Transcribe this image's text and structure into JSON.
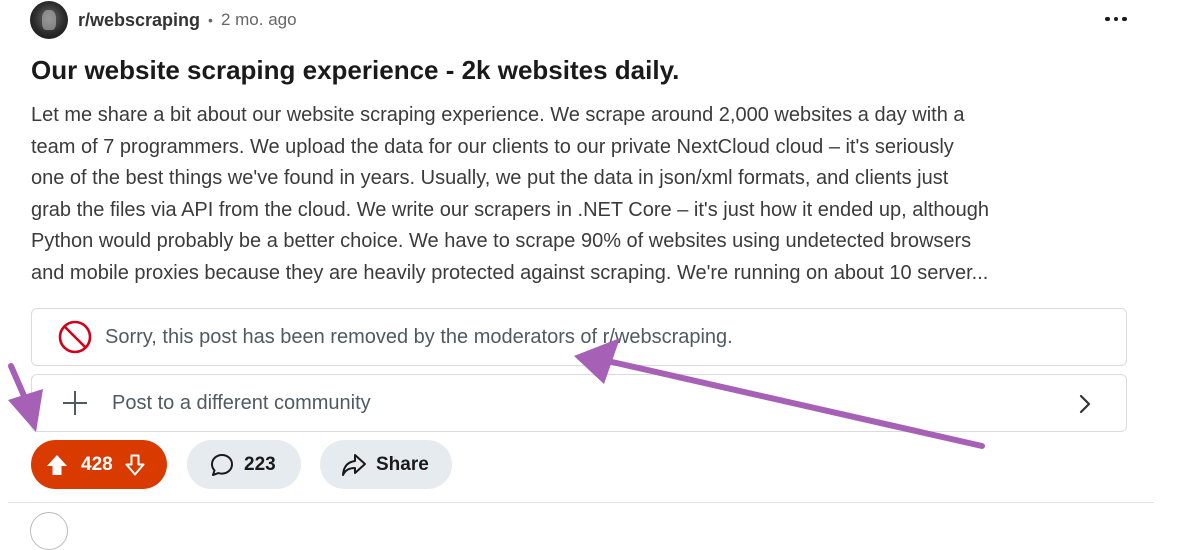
{
  "post": {
    "subreddit": "r/webscraping",
    "separator": "•",
    "time_ago": "2 mo. ago",
    "title": "Our website scraping experience - 2k websites daily.",
    "body_lines": [
      "Let me share a bit about our website scraping experience. We scrape around 2,000 websites a day with a",
      "team of 7 programmers. We upload the data for our clients to our private NextCloud cloud – it's seriously",
      "one of the best things we've found in years. Usually, we put the data in json/xml formats, and clients just",
      "grab the files via API from the cloud. We write our scrapers in .NET Core – it's just how it ended up, although",
      "Python would probably be a better choice. We have to scrape 90% of websites using undetected browsers",
      "and mobile proxies because they are heavily protected against scraping. We're running on about 10 server..."
    ],
    "removed_notice": "Sorry, this post has been removed by the moderators of r/webscraping.",
    "crosspost_label": "Post to a different community"
  },
  "actions": {
    "upvotes": "428",
    "comments": "223",
    "share_label": "Share"
  },
  "icons": {
    "more": "more-options-icon",
    "removed": "prohibited-icon",
    "crosspost": "plus-icon",
    "chevron": "chevron-right-icon",
    "upvote": "upvote-arrow-icon",
    "downvote": "downvote-arrow-icon",
    "comment": "comment-bubble-icon",
    "share": "share-arrow-icon"
  },
  "colors": {
    "upvote_active": "#d93a00",
    "pill_background": "#e5ebee",
    "removed_icon": "#d0021b",
    "annotation_arrow": "#a660b5"
  }
}
